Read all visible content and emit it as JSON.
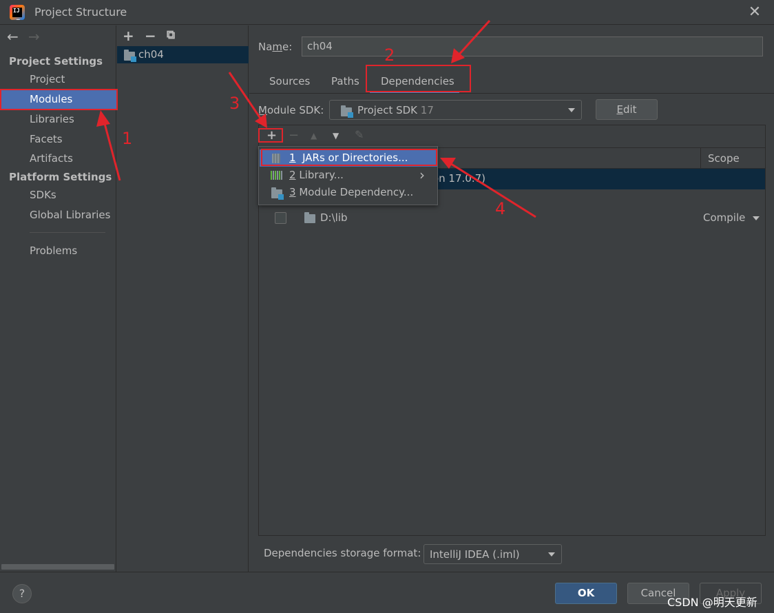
{
  "window": {
    "title": "Project Structure",
    "close_glyph": "✕"
  },
  "sidebar": {
    "back_glyph": "←",
    "forward_glyph": "→",
    "project_settings_heading": "Project Settings",
    "project_items": [
      "Project",
      "Modules",
      "Libraries",
      "Facets",
      "Artifacts"
    ],
    "platform_settings_heading": "Platform Settings",
    "platform_items": [
      "SDKs",
      "Global Libraries"
    ],
    "problems": "Problems",
    "selected": "Modules"
  },
  "modules_panel": {
    "toolbar": {
      "add_glyph": "+",
      "remove_glyph": "−",
      "copy_glyph": "⧉"
    },
    "tree": [
      {
        "name": "ch04",
        "icon": "module-folder-icon"
      }
    ]
  },
  "module": {
    "name_label_prefix": "Na",
    "name_label_mnemonic": "m",
    "name_label_suffix": "e:",
    "name_value": "ch04",
    "tabs": [
      "Sources",
      "Paths",
      "Dependencies"
    ],
    "active_tab": "Dependencies",
    "sdk_label_mnemonic": "M",
    "sdk_label_rest": "odule SDK:",
    "sdk_value": "Project SDK",
    "sdk_version": "17",
    "edit_label_mnemonic": "E",
    "edit_label_rest": "dit"
  },
  "dependencies": {
    "toolbar": {
      "add_glyph": "+",
      "remove_glyph": "−",
      "up_glyph": "▲",
      "down_glyph": "▼",
      "edit_glyph": "✎"
    },
    "scope_header": "Scope",
    "rows": [
      {
        "text": "sion 17.0.7)",
        "scope": ""
      },
      {
        "text": "D:\\lib",
        "scope": "Compile"
      }
    ]
  },
  "add_popup": {
    "items": [
      {
        "num": "1",
        "label": "JARs or Directories...",
        "icon": "jar-icon",
        "selected": true
      },
      {
        "num": "2",
        "label": "Library...",
        "icon": "library-icon",
        "has_submenu": true,
        "submenu_glyph": "›"
      },
      {
        "num": "3",
        "label": "Module Dependency...",
        "icon": "module-folder-icon"
      }
    ]
  },
  "storage": {
    "label": "Dependencies storage format:",
    "value": "IntelliJ IDEA (.iml)"
  },
  "footer": {
    "help_glyph": "?",
    "ok": "OK",
    "cancel": "Cancel",
    "apply": "Apply",
    "watermark": "CSDN @明天更新"
  },
  "annotations": {
    "color": "#e0242b",
    "numbers": [
      "1",
      "2",
      "3",
      "4"
    ]
  },
  "colors": {
    "selection": "#4b6eaf",
    "tree_selection": "#0d293e",
    "background": "#3c3f41"
  }
}
